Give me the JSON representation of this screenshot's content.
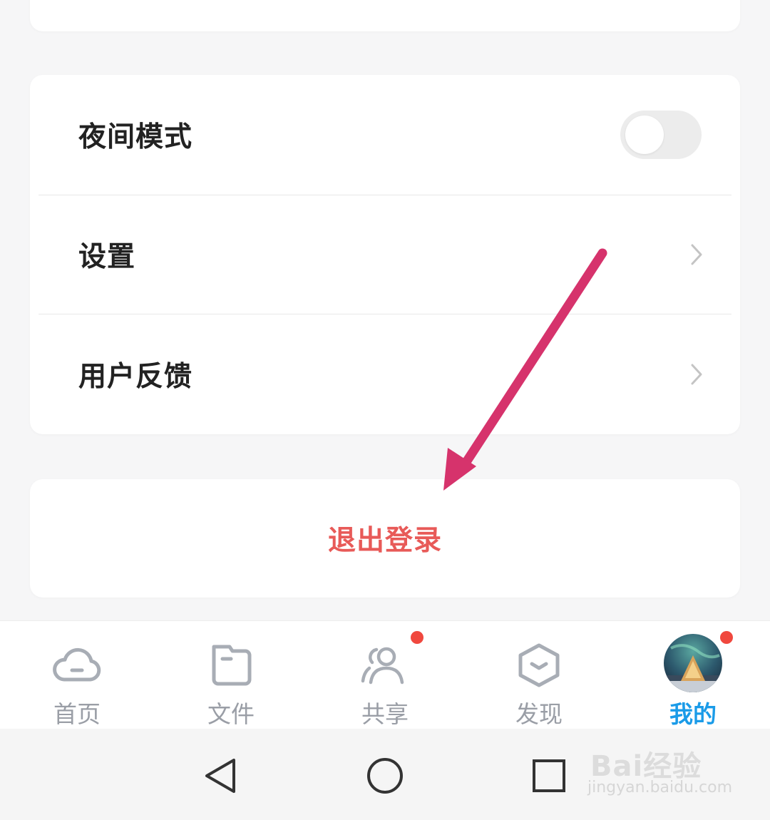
{
  "menu": {
    "items": [
      {
        "label": "夜间模式",
        "type": "toggle",
        "checked": false
      },
      {
        "label": "设置",
        "type": "link"
      },
      {
        "label": "用户反馈",
        "type": "link"
      }
    ]
  },
  "logout": {
    "label": "退出登录",
    "color": "#e85a58"
  },
  "annotation": {
    "arrow_color": "#d6336c"
  },
  "tabbar": {
    "tabs": [
      {
        "label": "首页",
        "icon": "cloud-icon",
        "active": false,
        "badge": false
      },
      {
        "label": "文件",
        "icon": "folder-icon",
        "active": false,
        "badge": false
      },
      {
        "label": "共享",
        "icon": "people-icon",
        "active": false,
        "badge": true
      },
      {
        "label": "发现",
        "icon": "hexagon-icon",
        "active": false,
        "badge": false
      },
      {
        "label": "我的",
        "icon": "avatar",
        "active": true,
        "badge": true
      }
    ],
    "active_color": "#1a9be8",
    "badge_color": "#f0483e"
  },
  "navbar": {
    "buttons": [
      "back-icon",
      "home-icon",
      "recents-icon"
    ]
  },
  "watermark": {
    "brand": "Bai经验",
    "url": "jingyan.baidu.com"
  }
}
